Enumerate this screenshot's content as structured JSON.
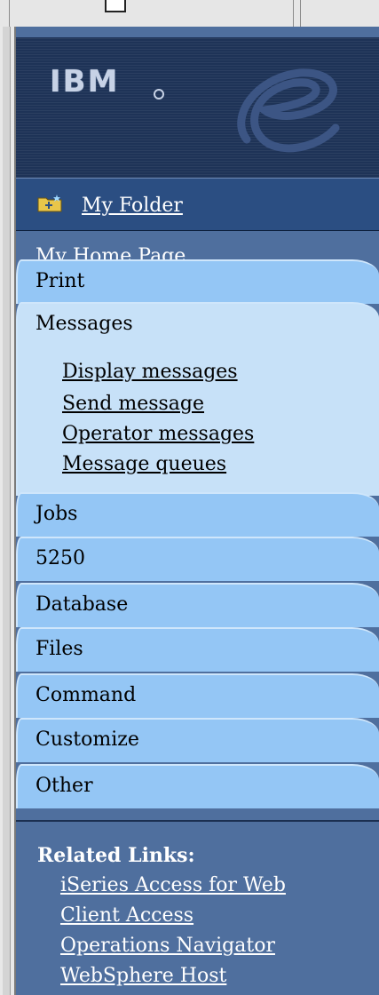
{
  "header": {
    "logo_text": "IBM"
  },
  "folder": {
    "label": "My Folder",
    "icon": "folder-icon"
  },
  "home": {
    "label": "My Home Page"
  },
  "nav": {
    "tabs": [
      {
        "label": "Print"
      },
      {
        "label": "Messages",
        "sub_items": [
          "Display messages",
          "Send message",
          "Operator messages",
          "Message queues"
        ]
      },
      {
        "label": "Jobs"
      },
      {
        "label": "5250"
      },
      {
        "label": "Database"
      },
      {
        "label": "Files"
      },
      {
        "label": "Command"
      },
      {
        "label": "Customize"
      },
      {
        "label": "Other"
      }
    ]
  },
  "related": {
    "title": "Related Links:",
    "links": [
      "iSeries Access for Web",
      "Client Access",
      "Operations Navigator",
      "WebSphere Host"
    ]
  },
  "colors": {
    "header_bg": "#1e3357",
    "folder_bg": "#2b4e82",
    "panel_bg": "#4f6f9e",
    "tab_bg": "#94c6f5",
    "tab_expanded_bg": "#c7e1f8"
  }
}
